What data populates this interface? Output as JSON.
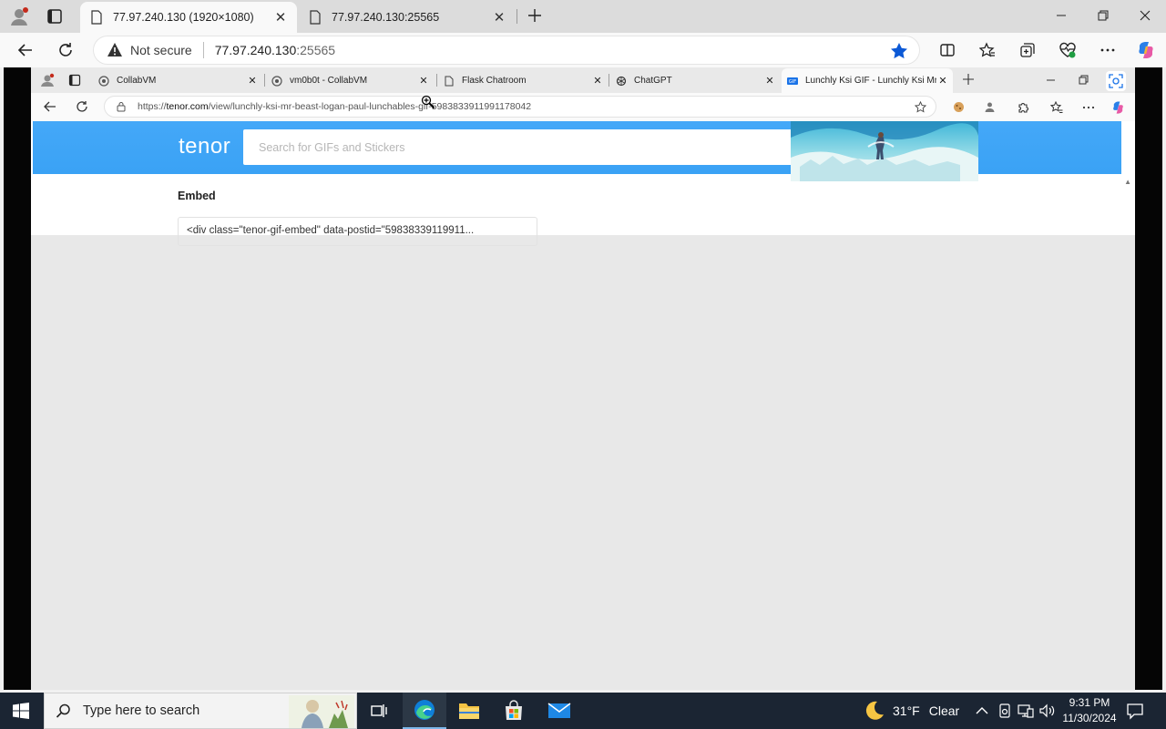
{
  "outer_browser": {
    "tabs": [
      {
        "title": "77.97.240.130 (1920×1080)",
        "icon": "page-icon",
        "active": true
      },
      {
        "title": "77.97.240.130:25565",
        "icon": "page-icon",
        "active": false
      }
    ],
    "address": {
      "security_label": "Not secure",
      "host": "77.97.240.130",
      "port": ":25565"
    }
  },
  "vm_browser": {
    "tabs": [
      {
        "title": "CollabVM",
        "icon": "collabvm-icon"
      },
      {
        "title": "vm0b0t - CollabVM",
        "icon": "collabvm-icon"
      },
      {
        "title": "Flask Chatroom",
        "icon": "page-icon"
      },
      {
        "title": "ChatGPT",
        "icon": "chatgpt-icon"
      },
      {
        "title": "Lunchly Ksi GIF - Lunchly Ksi Mr B",
        "icon": "gif-icon",
        "active": true
      }
    ],
    "address": {
      "prefix": "https://",
      "domain": "tenor.com",
      "path": "/view/lunchly-ksi-mr-beast-logan-paul-lunchables-gif-5983833911991178042"
    }
  },
  "tenor": {
    "logo": "tenor",
    "search_placeholder": "Search for GIFs and Stickers",
    "embed_title": "Embed",
    "embed_code": "<div class=\"tenor-gif-embed\" data-postid=\"59838339119911..."
  },
  "taskbar": {
    "search_placeholder": "Type here to search",
    "weather_temp": "31°F",
    "weather_condition": "Clear",
    "time": "9:31 PM",
    "date": "11/30/2024"
  },
  "colors": {
    "tenor_blue": "#3ea6ff",
    "taskbar_bg": "#1b2533",
    "edge_star_blue": "#0c59d6"
  }
}
